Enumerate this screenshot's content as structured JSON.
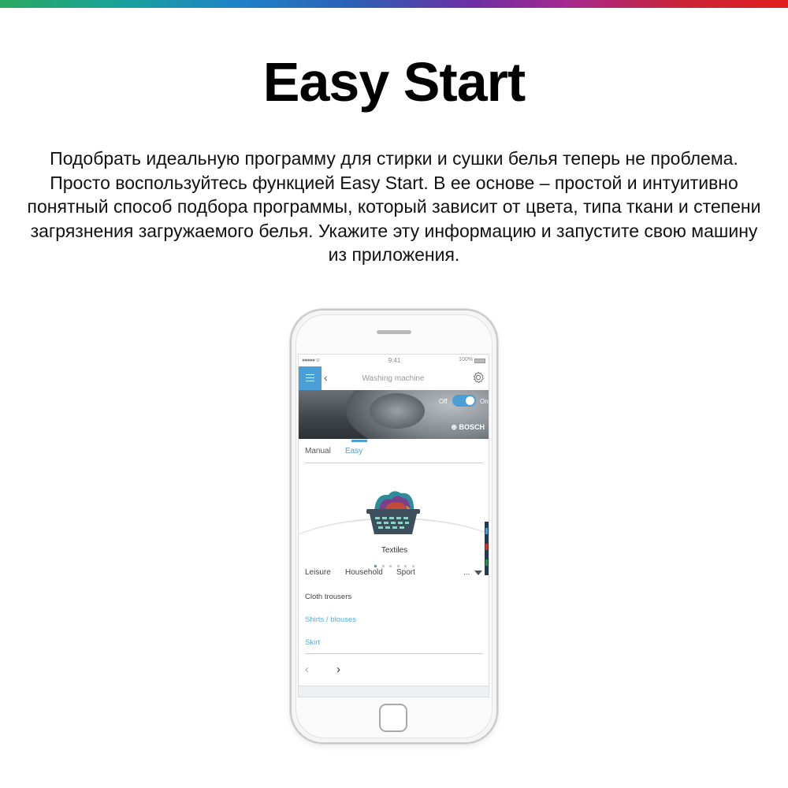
{
  "page": {
    "title": "Easy Start",
    "intro": "Подобрать идеальную программу для стирки и сушки белья теперь не проблема. Просто воспользуйтесь функцией Easy Start. В ее основе – простой и интуитивно понятный способ подбора программы, который зависит от цвета, типа ткани и степени загрязнения загружаемого белья. Укажите эту информацию и запустите свою машину из приложения."
  },
  "colors": {
    "accent": "#4a9fd6",
    "link": "#5aacdf",
    "edge_marker": "#1f3a52"
  },
  "status_bar": {
    "signal": "●●●●● ᯤ",
    "time": "9:41",
    "battery": "100%"
  },
  "nav": {
    "menu_icon": "hamburger-icon",
    "back_icon": "chevron-left-icon",
    "title": "Washing machine",
    "settings_icon": "gear-icon"
  },
  "banner": {
    "off_label": "Off",
    "on_label": "On",
    "toggle_state": "on",
    "brand": "⊕ BOSCH"
  },
  "modes": {
    "items": [
      "Manual",
      "Easy"
    ],
    "selected": "Easy"
  },
  "category": {
    "icon": "laundry-basket-icon",
    "label": "Textiles",
    "page_index": 1,
    "page_count": 6
  },
  "filters": {
    "items": [
      "Leisure",
      "Household",
      "Sport"
    ],
    "more": "...",
    "dropdown_icon": "triangle-down-icon"
  },
  "list": {
    "items": [
      "Cloth trousers",
      "Shirts / blouses",
      "Skirt"
    ]
  },
  "pagination": {
    "prev": "‹",
    "next": "›"
  }
}
